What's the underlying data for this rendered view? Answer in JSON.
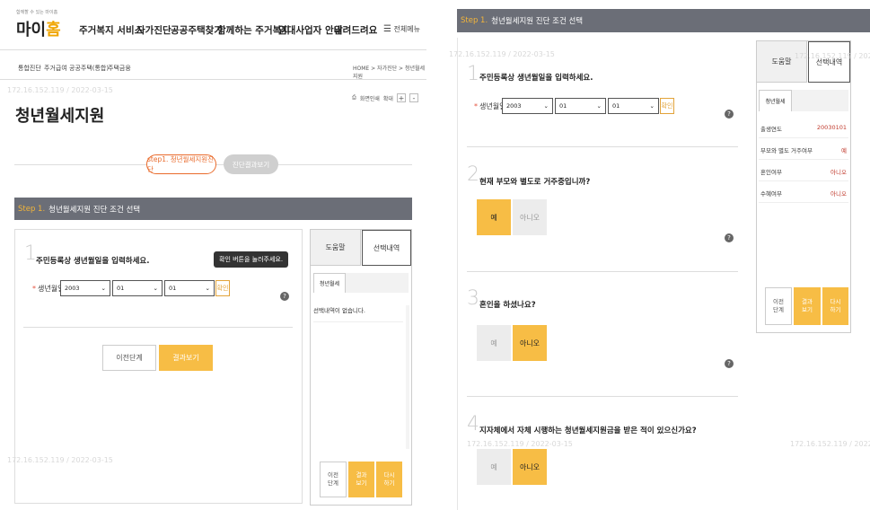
{
  "header": {
    "logo_small": "함께할 수 있는 마이홈",
    "logo_prefix": "마이",
    "logo_suffix": "홈",
    "nav": [
      "주거복지 서비스",
      "자가진단",
      "공공주택찾기",
      "함께하는 주거복지",
      "임대사업자 안내",
      "알려드려요"
    ],
    "menu_all": "전체메뉴"
  },
  "subnav": {
    "items": [
      "통합진단",
      "주거급여",
      "공공주택(통합)",
      "주택금융"
    ],
    "breadcrumb": "HOME > 자가진단 > 청년월세지원"
  },
  "tools": {
    "print": "화면인쇄",
    "zoom_label": "확대",
    "plus": "+",
    "minus": "-"
  },
  "page_title": "청년월세지원",
  "watermark": "172.16.152.119 / 2022-03-15",
  "steps": {
    "step1": "step1. 청년월세지원진단",
    "step2": "진단결과보기"
  },
  "bar_step": "Step 1.",
  "bar_title": "청년월세지원 진단 조건 선택",
  "q1": {
    "num": "1",
    "text": "주민등록상 생년월일을 입력하세요.",
    "label_star": "*",
    "label": "생년월일",
    "year": "2003",
    "month": "01",
    "day": "01",
    "confirm": "확인",
    "tooltip": "확인 버튼을 눌러주세요."
  },
  "q2": {
    "num": "2",
    "text": "현재 부모와 별도로 거주중입니까?",
    "yes": "예",
    "no": "아니오"
  },
  "q3": {
    "num": "3",
    "text": "혼인을 하셨나요?",
    "yes": "예",
    "no": "아니오"
  },
  "q4": {
    "num": "4",
    "text": "지자체에서 자체 시행하는 청년월세지원금을 받은 적이 있으신가요?",
    "yes": "예",
    "no": "아니오"
  },
  "help_icon": "?",
  "buttons": {
    "prev": "이전단계",
    "result": "결과보기"
  },
  "side": {
    "tab_help": "도움말",
    "tab_selected": "선택내역",
    "inner_tab": "청년월세",
    "empty": "선택내역이 없습니다.",
    "btn_prev": [
      "이전",
      "단계"
    ],
    "btn_result": [
      "결과",
      "보기"
    ],
    "btn_retry": [
      "다시",
      "하기"
    ],
    "rows": [
      {
        "label": "출생연도",
        "value": "20030101"
      },
      {
        "label": "부모와 별도 거주여부",
        "value": "예"
      },
      {
        "label": "혼인여부",
        "value": "아니오"
      },
      {
        "label": "수혜여부",
        "value": "아니오"
      }
    ]
  },
  "colors": {
    "accent": "#f7bd45",
    "bar": "#6b6e77",
    "pill": "#e96b2c"
  }
}
